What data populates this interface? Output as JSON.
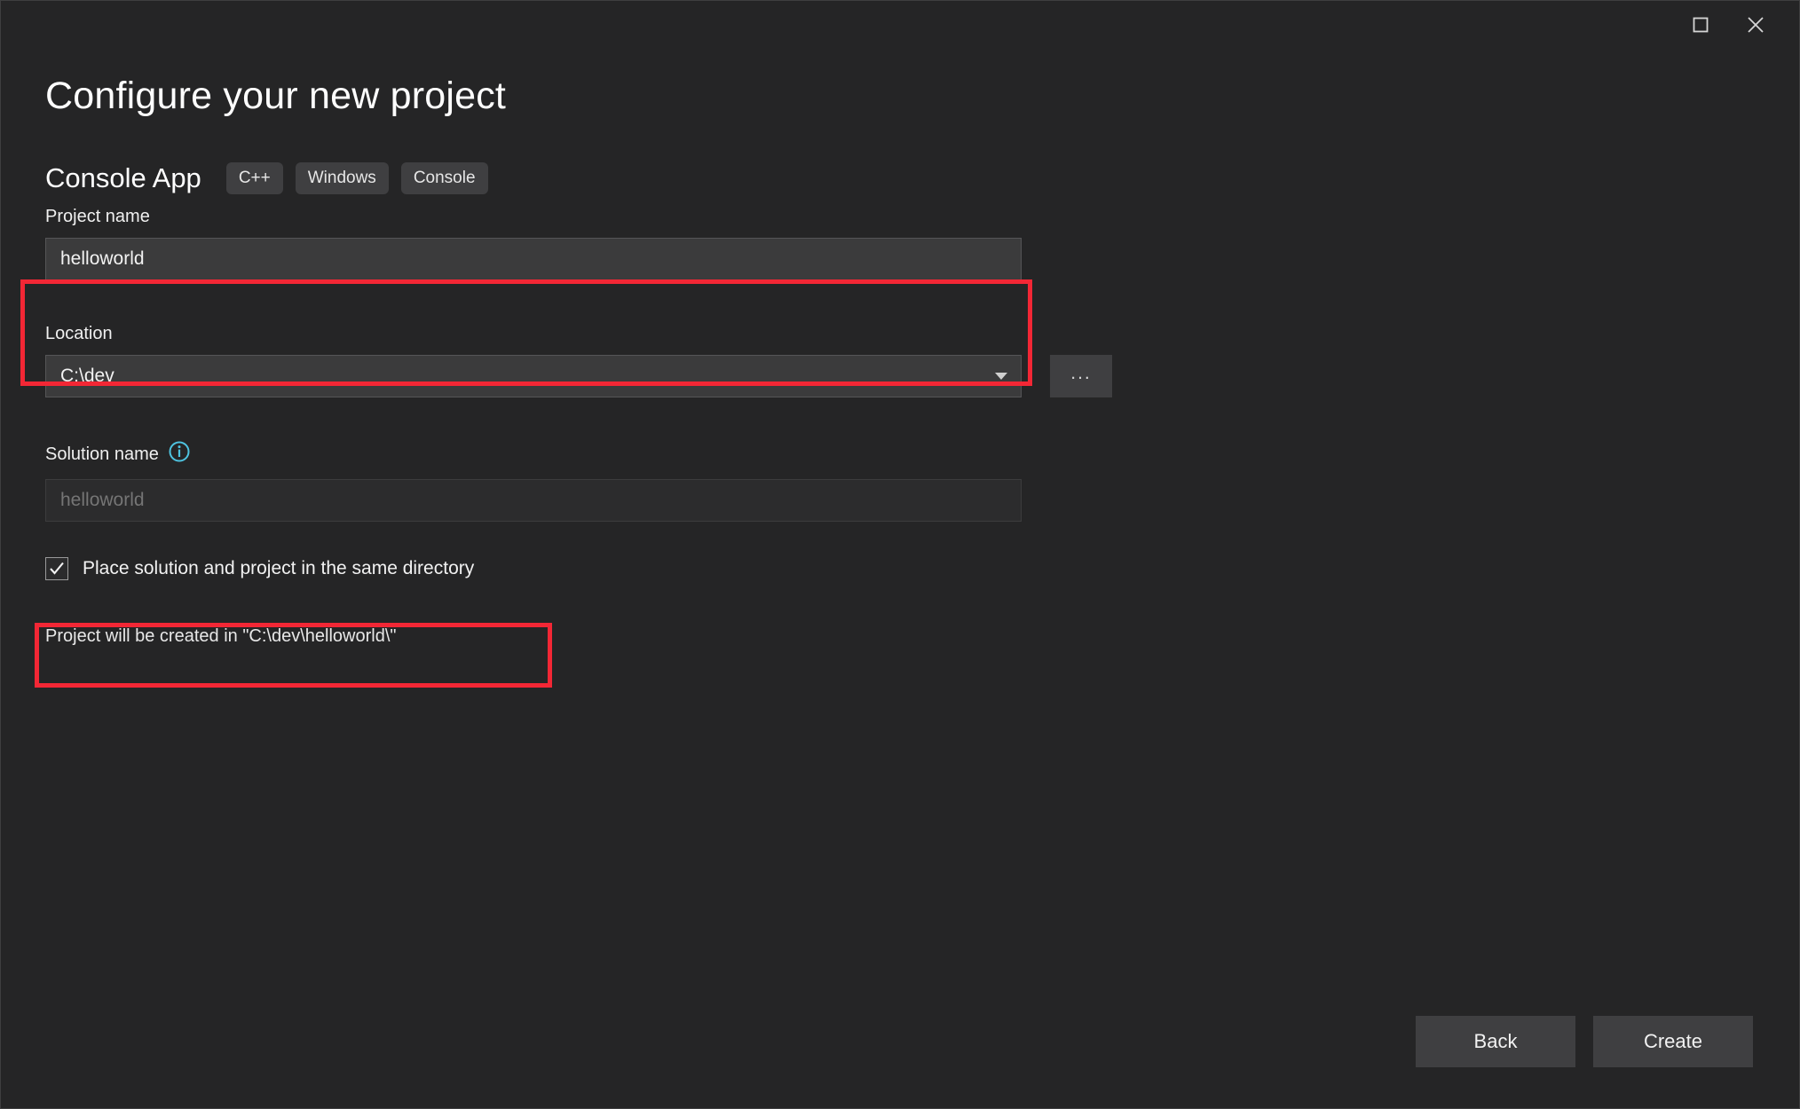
{
  "window": {
    "maximize_label": "Maximize",
    "close_label": "Close"
  },
  "header": {
    "title": "Configure your new project",
    "template_name": "Console App",
    "tags": [
      "C++",
      "Windows",
      "Console"
    ]
  },
  "form": {
    "project_name": {
      "label": "Project name",
      "value": "helloworld"
    },
    "location": {
      "label": "Location",
      "value": "C:\\dev",
      "browse_label": "...",
      "dropdown_icon": "chevron-down-icon"
    },
    "solution_name": {
      "label": "Solution name",
      "info_icon": "info-icon",
      "placeholder": "helloworld",
      "value": "",
      "disabled": true
    },
    "same_directory_checkbox": {
      "label": "Place solution and project in the same directory",
      "checked": true,
      "check_glyph": "✓"
    },
    "status_text": "Project will be created in \"C:\\dev\\helloworld\\\""
  },
  "footer": {
    "back_label": "Back",
    "create_label": "Create"
  },
  "colors": {
    "dialog_background": "#252526",
    "input_background": "#3b3b3c",
    "pill_background": "#3f3f41",
    "highlight_red": "#f32735",
    "info_icon_cyan": "#4ec3e0",
    "text_primary": "#f2f2f2",
    "text_disabled": "#6e6e6e"
  }
}
